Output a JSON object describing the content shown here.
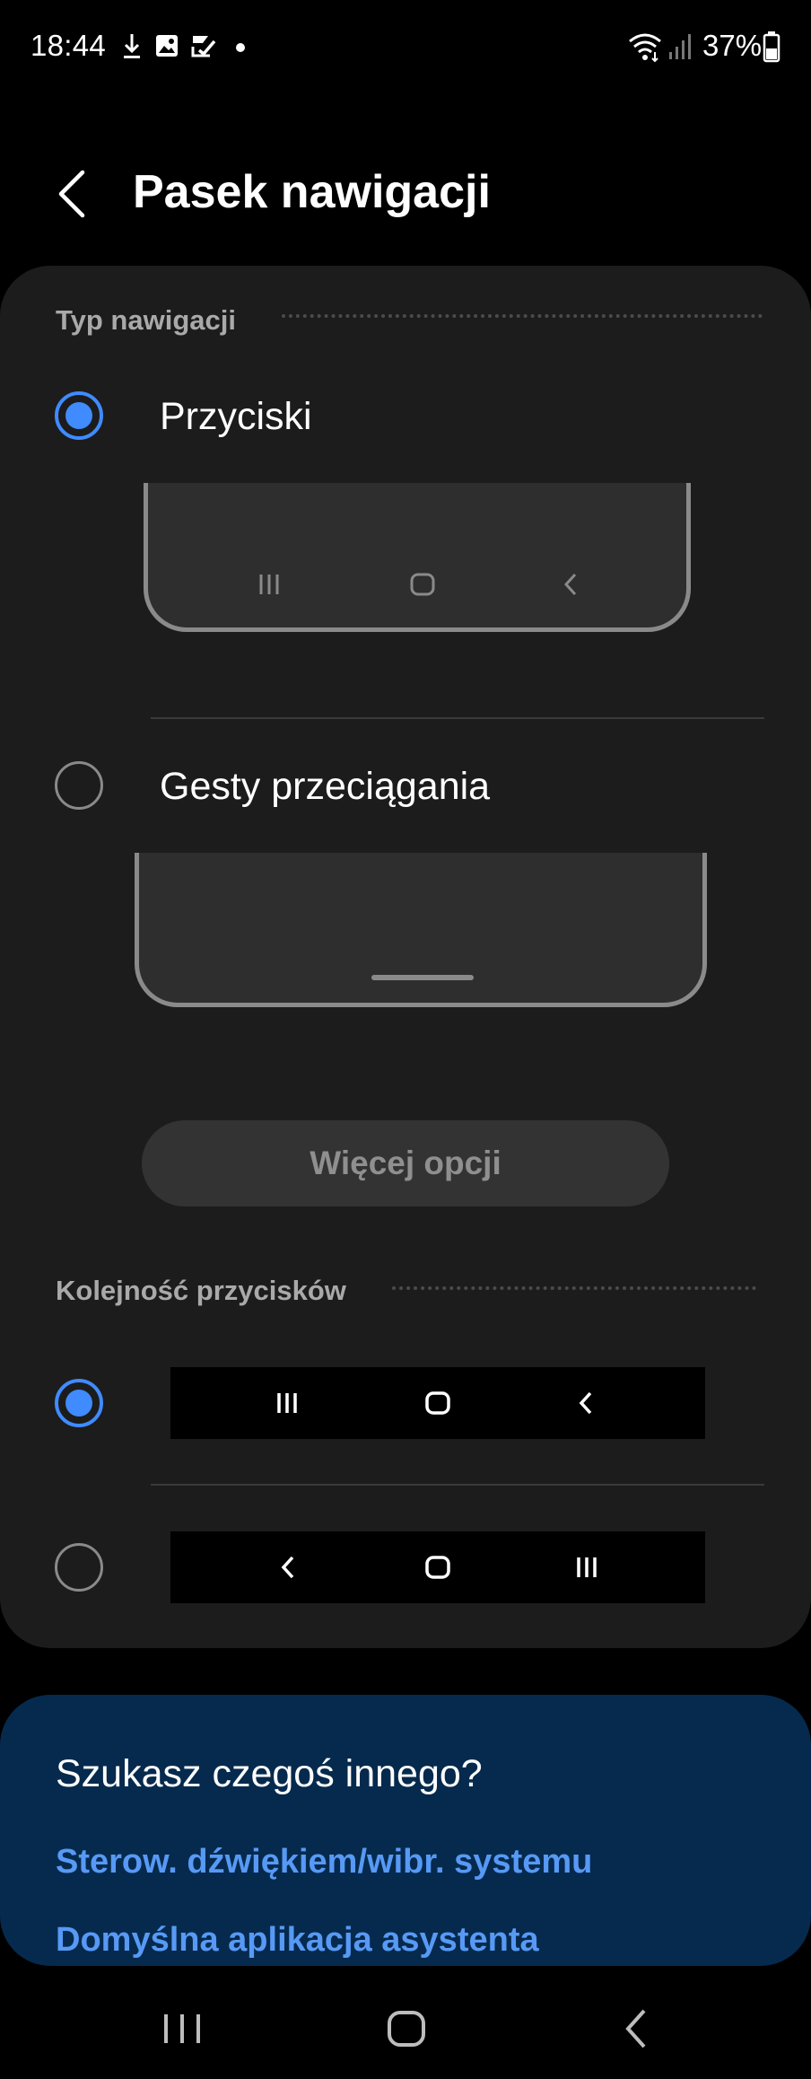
{
  "status_bar": {
    "time": "18:44",
    "battery": "37%",
    "icons": [
      "download-icon",
      "image-icon",
      "tasks-icon",
      "dot-icon",
      "wifi-icon",
      "signal-icon",
      "battery-icon"
    ]
  },
  "header": {
    "title": "Pasek nawigacji"
  },
  "navigation_type": {
    "section_title": "Typ nawigacji",
    "options": [
      {
        "label": "Przyciski",
        "selected": true
      },
      {
        "label": "Gesty przeciągania",
        "selected": false
      }
    ],
    "more_options_label": "Więcej opcji"
  },
  "button_order": {
    "section_title": "Kolejność przycisków",
    "options": [
      {
        "selected": true,
        "order": [
          "recents-icon",
          "home-icon",
          "back-icon"
        ]
      },
      {
        "selected": false,
        "order": [
          "back-icon",
          "home-icon",
          "recents-icon"
        ]
      }
    ]
  },
  "help": {
    "title": "Szukasz czegoś innego?",
    "links": [
      "Sterow. dźwiękiem/wibr. systemu",
      "Domyślna aplikacja asystenta"
    ]
  },
  "colors": {
    "accent": "#3f8bff",
    "link": "#5799f5",
    "card": "#1c1c1c",
    "help_card": "#062a4d"
  }
}
